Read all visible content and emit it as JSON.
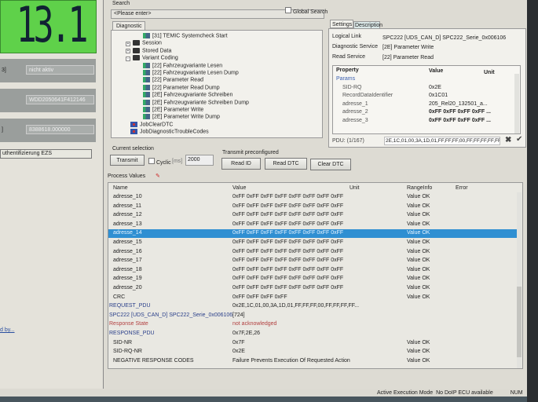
{
  "left_panel": {
    "display_value": "13.1",
    "fields": [
      {
        "label": "3]",
        "value": "nicht aktiv"
      },
      {
        "label": "",
        "value": "WDD2050641F412146"
      },
      {
        "label": "]",
        "value": "8388618.000000"
      }
    ],
    "auth_button": "uthentifizierung EZS",
    "link": "d by..."
  },
  "search": {
    "label": "Search",
    "placeholder": "<Please enter>",
    "global_search": "Global Search"
  },
  "tree": {
    "tab": "Diagnostic",
    "items": [
      {
        "label": "[31] TEMIC Systemcheck Start",
        "type": "service",
        "level": 2
      },
      {
        "label": "Session",
        "type": "folder",
        "level": 1,
        "toggle": "+"
      },
      {
        "label": "Stored Data",
        "type": "folder",
        "level": 1,
        "toggle": "+"
      },
      {
        "label": "Variant Coding",
        "type": "folder",
        "level": 1,
        "toggle": "-"
      },
      {
        "label": "[22] Fahrzeugvariante Lesen",
        "type": "service",
        "level": 2
      },
      {
        "label": "[22] Fahrzeugvariante Lesen Dump",
        "type": "service",
        "level": 2
      },
      {
        "label": "[22] Parameter Read",
        "type": "service",
        "level": 2
      },
      {
        "label": "[22] Parameter Read Dump",
        "type": "service",
        "level": 2
      },
      {
        "label": "[2E] Fahrzeugvariante Schreiben",
        "type": "service",
        "level": 2
      },
      {
        "label": "[2E] Fahrzeugvariante Schreiben Dump",
        "type": "service",
        "level": 2
      },
      {
        "label": "[2E] Parameter Write",
        "type": "service",
        "level": 2
      },
      {
        "label": "[2E] Parameter Write Dump",
        "type": "service",
        "level": 2
      },
      {
        "label": "JobClearDTC",
        "type": "job",
        "level": 0
      },
      {
        "label": "JobDiagnosticTroubleCodes",
        "type": "job",
        "level": 0
      }
    ]
  },
  "settings": {
    "tabs": [
      "Settings",
      "Description"
    ],
    "logical_link_label": "Logical Link",
    "logical_link": "SPC222 [UDS_CAN_D] SPC222_Serie_0x006106",
    "diag_service_label": "Diagnostic Service",
    "diag_service": "[2E] Parameter Write",
    "read_service_label": "Read Service",
    "read_service": "[22] Parameter Read",
    "columns": [
      "Property",
      "Value",
      "Unit"
    ],
    "rows": [
      {
        "name": "Params",
        "value": ""
      },
      {
        "name": "SID-RQ",
        "value": "0x2E"
      },
      {
        "name": "RecordDataIdentifier",
        "value": "0x1C01"
      },
      {
        "name": "adresse_1",
        "value": "205_Rel20_132501_a..."
      },
      {
        "name": "adresse_2",
        "value": "0xFF 0xFF 0xFF 0xFF ..."
      },
      {
        "name": "adresse_3",
        "value": "0xFF 0xFF 0xFF 0xFF ..."
      }
    ],
    "pdu_label": "PDU: (1/167)",
    "pdu": "2E,1C,01,00,3A,1D,01,FF,FF,FF,00,FF,FF,FF,FF,FF,FF"
  },
  "current_selection": {
    "label": "Current selection",
    "transmit": "Transmit",
    "cyclic": "Cyclic",
    "ms": "[ms]",
    "interval": "2000"
  },
  "preconfigured": {
    "label": "Transmit preconfigured",
    "read_id": "Read ID",
    "read_dtc": "Read DTC",
    "clear_dtc": "Clear DTC"
  },
  "process_values": {
    "label": "Process Values",
    "columns": [
      "Name",
      "Value",
      "Unit",
      "RangeInfo",
      "Error"
    ],
    "rows": [
      {
        "name": "adresse_10",
        "value": "0xFF 0xFF 0xFF 0xFF 0xFF 0xFF 0xFF 0xFF",
        "range": "Value OK"
      },
      {
        "name": "adresse_11",
        "value": "0xFF 0xFF 0xFF 0xFF 0xFF 0xFF 0xFF 0xFF",
        "range": "Value OK"
      },
      {
        "name": "adresse_12",
        "value": "0xFF 0xFF 0xFF 0xFF 0xFF 0xFF 0xFF 0xFF",
        "range": "Value OK"
      },
      {
        "name": "adresse_13",
        "value": "0xFF 0xFF 0xFF 0xFF 0xFF 0xFF 0xFF 0xFF",
        "range": "Value OK"
      },
      {
        "name": "adresse_14",
        "value": "0xFF 0xFF 0xFF 0xFF 0xFF 0xFF 0xFF 0xFF",
        "range": "Value OK",
        "selected": true
      },
      {
        "name": "adresse_15",
        "value": "0xFF 0xFF 0xFF 0xFF 0xFF 0xFF 0xFF 0xFF",
        "range": "Value OK"
      },
      {
        "name": "adresse_16",
        "value": "0xFF 0xFF 0xFF 0xFF 0xFF 0xFF 0xFF 0xFF",
        "range": "Value OK"
      },
      {
        "name": "adresse_17",
        "value": "0xFF 0xFF 0xFF 0xFF 0xFF 0xFF 0xFF 0xFF",
        "range": "Value OK"
      },
      {
        "name": "adresse_18",
        "value": "0xFF 0xFF 0xFF 0xFF 0xFF 0xFF 0xFF 0xFF",
        "range": "Value OK"
      },
      {
        "name": "adresse_19",
        "value": "0xFF 0xFF 0xFF 0xFF 0xFF 0xFF 0xFF 0xFF",
        "range": "Value OK"
      },
      {
        "name": "adresse_20",
        "value": "0xFF 0xFF 0xFF 0xFF 0xFF 0xFF 0xFF 0xFF",
        "range": "Value OK"
      },
      {
        "name": "CRC",
        "value": "0xFF 0xFF 0xFF 0xFF",
        "range": "Value OK"
      },
      {
        "name": "REQUEST_PDU",
        "value": "0x2E,1C,01,00,3A,1D,01,FF,FF,FF,00,FF,FF,FF,FF...",
        "range": "",
        "style": "dark",
        "indent": 0
      },
      {
        "name": "SPC222 [UDS_CAN_D] SPC222_Serie_0x006106",
        "value": "[724]",
        "range": "",
        "style": "blue",
        "indent": 0
      },
      {
        "name": "Response State",
        "value": "not acknowledged",
        "range": "",
        "style": "red",
        "indent": 0
      },
      {
        "name": "RESPONSE_PDU",
        "value": "0x7F,2E,26",
        "range": "",
        "style": "dark",
        "indent": 0
      },
      {
        "name": "SID-NR",
        "value": "0x7F",
        "range": "Value OK"
      },
      {
        "name": "SID-RQ-NR",
        "value": "0x2E",
        "range": "Value OK"
      },
      {
        "name": "NEGATIVE RESPONSE CODES",
        "value": "Failure Prevents Execution Of Requested Action",
        "range": "Value OK"
      }
    ]
  },
  "status_bar": {
    "mode": "Active Execution Mode",
    "doip": "No DoIP ECU available",
    "num": "NUM"
  },
  "colors": {
    "selection": "#2f8fd2",
    "lcd": "#5fd14a",
    "error_text": "#b24040",
    "link_text": "#2a3f8a"
  }
}
